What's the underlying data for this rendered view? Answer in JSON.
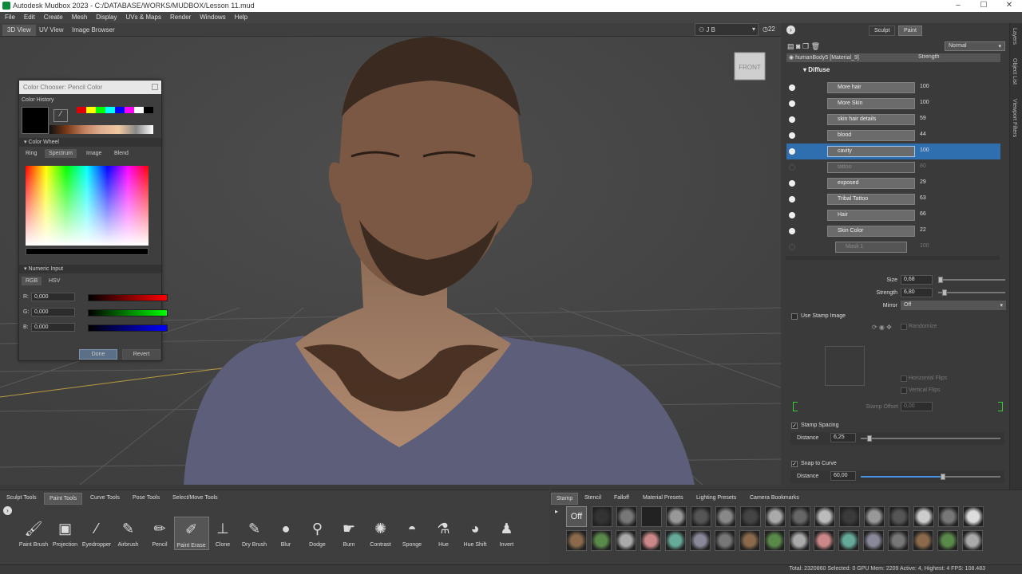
{
  "window": {
    "title": "Autodesk Mudbox 2023 - C:/DATABASE/WORKS/MUDBOX/Lesson 11.mud",
    "minimize": "–",
    "maximize": "☐",
    "close": "✕"
  },
  "menu": [
    "File",
    "Edit",
    "Create",
    "Mesh",
    "Display",
    "UVs & Maps",
    "Render",
    "Windows",
    "Help"
  ],
  "view_tabs": [
    "3D View",
    "UV View",
    "Image Browser"
  ],
  "user": {
    "name": "J B",
    "badge": "22"
  },
  "viewcube": {
    "label": "FRONT"
  },
  "color_chooser": {
    "title": "Color Chooser: Pencil Color",
    "history_label": "Color History",
    "wheel_label": "Color Wheel",
    "tabs": [
      "Ring",
      "Spectrum",
      "Image",
      "Blend"
    ],
    "numeric_label": "Numeric Input",
    "modes": [
      "RGB",
      "HSV"
    ],
    "channels": [
      {
        "label": "R:",
        "value": "0,000"
      },
      {
        "label": "G:",
        "value": "0,000"
      },
      {
        "label": "B:",
        "value": "0,000"
      }
    ],
    "done": "Done",
    "revert": "Revert",
    "history_colors": [
      "#e00000",
      "#ffff00",
      "#00ff00",
      "#00ffff",
      "#0000ff",
      "#ff00ff",
      "#ffffff",
      "#000000"
    ]
  },
  "right_panel": {
    "mode_tabs": [
      "Sculpt",
      "Paint"
    ],
    "blend_mode": "Normal",
    "layer_header": "humanBody5 [Material_9]",
    "strength_header": "Strength",
    "channel": "Diffuse",
    "layers": [
      {
        "name": "More hair",
        "value": "100",
        "visible": true
      },
      {
        "name": "More Skin",
        "value": "100",
        "visible": true
      },
      {
        "name": "skin hair details",
        "value": "59",
        "visible": true
      },
      {
        "name": "blood",
        "value": "44",
        "visible": true
      },
      {
        "name": "cavity",
        "value": "100",
        "visible": true,
        "selected": true
      },
      {
        "name": "tattoo",
        "value": "80",
        "visible": false
      },
      {
        "name": "exposed",
        "value": "29",
        "visible": true
      },
      {
        "name": "Tribal Tattoo",
        "value": "63",
        "visible": true
      },
      {
        "name": "Hair",
        "value": "66",
        "visible": true
      },
      {
        "name": "Skin Color",
        "value": "22",
        "visible": true
      },
      {
        "name": "Mask 1",
        "value": "100",
        "visible": false
      }
    ],
    "props": {
      "size_label": "Size",
      "size": "0,68",
      "strength_label": "Strength",
      "strength": "6,80",
      "mirror_label": "Mirror",
      "mirror": "Off",
      "stamp_image": "Use Stamp Image",
      "randomize": "Randomize",
      "hflip": "Horizontal Flips",
      "vflip": "Vertical Flips",
      "stamp_offset_label": "Stamp Offset",
      "stamp_offset": "0,00",
      "stamp_spacing": "Stamp Spacing",
      "distance_label": "Distance",
      "distance1": "6,25",
      "snap": "Snap to Curve",
      "distance2": "60,00"
    }
  },
  "side_tabs": [
    "Layers",
    "Object List",
    "Viewport Filters"
  ],
  "tool_tabs": [
    "Sculpt Tools",
    "Paint Tools",
    "Curve Tools",
    "Pose Tools",
    "Select/Move Tools"
  ],
  "tools": [
    {
      "label": "Paint Brush",
      "icon": "🖌"
    },
    {
      "label": "Projection",
      "icon": "▣"
    },
    {
      "label": "Eyedropper",
      "icon": "⁄"
    },
    {
      "label": "Airbrush",
      "icon": "✎"
    },
    {
      "label": "Pencil",
      "icon": "✏"
    },
    {
      "label": "Paint Erase",
      "icon": "✐",
      "active": true
    },
    {
      "label": "Clone",
      "icon": "⊥"
    },
    {
      "label": "Dry Brush",
      "icon": "✎"
    },
    {
      "label": "Blur",
      "icon": "●"
    },
    {
      "label": "Dodge",
      "icon": "⚲"
    },
    {
      "label": "Burn",
      "icon": "☛"
    },
    {
      "label": "Contrast",
      "icon": "✺"
    },
    {
      "label": "Sponge",
      "icon": "◓"
    },
    {
      "label": "Hue",
      "icon": "⚗"
    },
    {
      "label": "Hue Shift",
      "icon": "◕"
    },
    {
      "label": "Invert",
      "icon": "♟"
    }
  ],
  "tray_tabs": [
    "Stamp",
    "Stencil",
    "Falloff",
    "Material Presets",
    "Lighting Presets",
    "Camera Bookmarks"
  ],
  "tray_off": "Off",
  "status": "Total: 2320860  Selected: 0 GPU Mem: 2209  Active: 4, Highest: 4  FPS: 108.483"
}
